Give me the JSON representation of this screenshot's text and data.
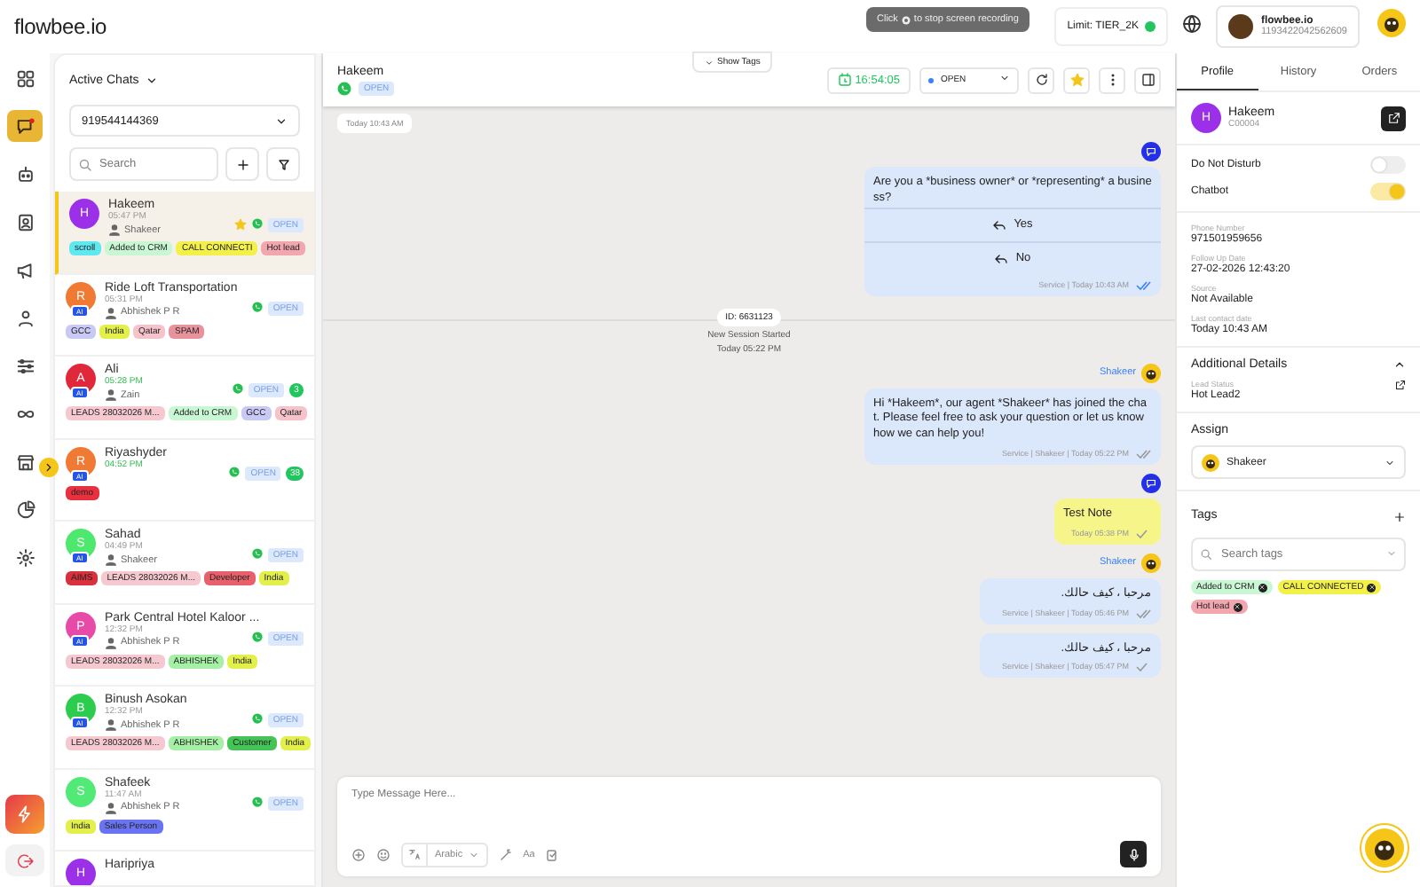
{
  "topbar": {
    "logo": "flowbee.io",
    "recording_tip": {
      "before": "Click",
      "after": "to stop screen recording"
    },
    "limit": "Limit:  TIER_2K",
    "account": {
      "name": "flowbee.io",
      "id": "1193422042562609"
    }
  },
  "nav": [
    {
      "kind": "grid",
      "selected": false
    },
    {
      "kind": "chat",
      "selected": true
    },
    {
      "kind": "bot",
      "selected": false
    },
    {
      "kind": "contact",
      "selected": false
    },
    {
      "kind": "megaphone",
      "selected": false
    },
    {
      "kind": "users",
      "selected": false
    },
    {
      "kind": "sliders",
      "selected": false
    },
    {
      "kind": "infinity",
      "selected": false
    },
    {
      "kind": "store",
      "selected": false
    },
    {
      "kind": "pie",
      "selected": false
    },
    {
      "kind": "gear",
      "selected": false
    }
  ],
  "chat_list": {
    "filter": "Active Chats",
    "number": "919544144369",
    "search_placeholder": "Search",
    "chats": [
      {
        "name": "Hakeem",
        "time": "05:47 PM",
        "agent": "Shakeer",
        "initial": "H",
        "color": "#9b30e8",
        "starred": true,
        "status": "OPEN",
        "selected": true,
        "tags": [
          {
            "label": "scroll",
            "color": "#5ee8f0"
          },
          {
            "label": "Added to CRM",
            "color": "#c9f7d4"
          },
          {
            "label": "CALL CONNECTI",
            "color": "#f3f04a"
          },
          {
            "label": "Hot lead",
            "color": "#f2a6ae"
          }
        ]
      },
      {
        "name": "Ride Loft Transportation",
        "time": "05:31 PM",
        "agent": "Abhishek P R",
        "initial": "R",
        "color": "#f07a34",
        "badge": "AI",
        "starred": false,
        "status": "OPEN",
        "selected": false,
        "tags": [
          {
            "label": "GCC",
            "color": "#c9c9f5"
          },
          {
            "label": "India",
            "color": "#e3f04a"
          },
          {
            "label": "Qatar",
            "color": "#f6c3cb"
          },
          {
            "label": "SPAM",
            "color": "#e8939b"
          }
        ]
      },
      {
        "name": "Ali",
        "time": "05:28 PM",
        "agent": "Zain",
        "initial": "A",
        "color": "#e0283a",
        "badge": "AI",
        "starred": false,
        "status": "OPEN",
        "unread": "3",
        "selected": false,
        "tags": [
          {
            "label": "LEADS 28032026 M...",
            "color": "#f6c8d0"
          },
          {
            "label": "Added to CRM",
            "color": "#c9f7d4"
          },
          {
            "label": "GCC",
            "color": "#c9c9f5"
          },
          {
            "label": "Qatar",
            "color": "#f6c3cb"
          }
        ]
      },
      {
        "name": "Riyashyder",
        "time": "04:52 PM",
        "initial": "R",
        "color": "#f07a34",
        "badge": "AI",
        "starred": false,
        "status": "OPEN",
        "unread": "38",
        "selected": false,
        "tags": [
          {
            "label": "demo",
            "color": "#e8303e"
          }
        ]
      },
      {
        "name": "Sahad",
        "time": "04:49 PM",
        "agent": "Shakeer",
        "initial": "S",
        "color": "#4ee86e",
        "badge": "AI",
        "starred": false,
        "status": "OPEN",
        "selected": false,
        "tags": [
          {
            "label": "AIMS",
            "color": "#d8303c"
          },
          {
            "label": "LEADS 28032026 M...",
            "color": "#f6c8d0"
          },
          {
            "label": "Developer",
            "color": "#e8606c"
          },
          {
            "label": "India",
            "color": "#e3f04a"
          }
        ]
      },
      {
        "name": "Park Central Hotel Kaloor ...",
        "time": "12:32 PM",
        "agent": "Abhishek P R",
        "initial": "P",
        "color": "#e84aa8",
        "badge": "AI",
        "starred": false,
        "status": "OPEN",
        "selected": false,
        "tags": [
          {
            "label": "LEADS 28032026 M...",
            "color": "#f6c8d0"
          },
          {
            "label": "ABHISHEK",
            "color": "#a6f0a6"
          },
          {
            "label": "India",
            "color": "#e3f04a"
          }
        ]
      },
      {
        "name": "Binush Asokan",
        "time": "12:32 PM",
        "agent": "Abhishek P R",
        "initial": "B",
        "color": "#2ccc4e",
        "badge": "AI",
        "starred": false,
        "status": "OPEN",
        "selected": false,
        "tags": [
          {
            "label": "LEADS 28032026 M...",
            "color": "#f6c8d0"
          },
          {
            "label": "ABHISHEK",
            "color": "#a6f0a6"
          },
          {
            "label": "Customer",
            "color": "#44c456"
          },
          {
            "label": "India",
            "color": "#e3f04a"
          }
        ]
      },
      {
        "name": "Shafeek",
        "time": "11:47 AM",
        "agent": "Abhishek P R",
        "initial": "S",
        "color": "#52ea76",
        "starred": false,
        "status": "OPEN",
        "selected": false,
        "tags": [
          {
            "label": "India",
            "color": "#e3f04a"
          },
          {
            "label": "Sales Person",
            "color": "#6a74f2"
          }
        ]
      },
      {
        "name": "Haripriya",
        "initial": "H",
        "color": "#9b30e8",
        "starred": false,
        "selected": false
      }
    ]
  },
  "conversation": {
    "name": "Hakeem",
    "status_badge": "OPEN",
    "show_tags": "Show Tags",
    "timer": "16:54:05",
    "status": "OPEN",
    "starred": true,
    "items": [
      {
        "kind": "date",
        "text": "Today 10:43 AM"
      },
      {
        "kind": "bot",
        "text": "Are you a *business owner* or *representing* a business?",
        "buttons": [
          "Yes",
          "No"
        ],
        "meta": "Service | Today 10:43 AM",
        "delivered": true,
        "read": true
      },
      {
        "kind": "session",
        "id": "ID: 6631123",
        "text": "New Session Started",
        "time": "Today 05:22 PM"
      },
      {
        "kind": "agent",
        "sender": "Shakeer",
        "text": "Hi *Hakeem*, our agent *Shakeer* has joined the chat. Please feel free to ask your question or let us know how we can help you!",
        "meta": "Service | Shakeer | Today 05:22 PM",
        "delivered": true,
        "read": false
      },
      {
        "kind": "note",
        "text": "Test Note",
        "meta": "Today 05:38 PM",
        "delivered": false,
        "read": false
      },
      {
        "kind": "agent",
        "sender": "Shakeer",
        "text": "مرحبا ، كيف حالك.",
        "meta": "Service | Shakeer | Today 05:46 PM",
        "delivered": true,
        "read": false
      },
      {
        "kind": "agent",
        "text": "مرحبا ، كيف حالك.",
        "meta": "Service | Shakeer | Today 05:47 PM",
        "delivered": false,
        "read": false
      }
    ],
    "composer": {
      "placeholder": "Type Message Here...",
      "language": "Arabic",
      "font_button": "Aa"
    }
  },
  "profile": {
    "tabs": [
      {
        "label": "Profile",
        "selected": true
      },
      {
        "label": "History",
        "selected": false
      },
      {
        "label": "Orders",
        "selected": false
      }
    ],
    "name": "Hakeem",
    "code": "C00004",
    "initial": "H",
    "toggles": [
      {
        "label": "Do Not Disturb",
        "on": false
      },
      {
        "label": "Chatbot",
        "on": true
      }
    ],
    "fields": [
      {
        "label": "Phone Number",
        "value": "971501959656"
      },
      {
        "label": "Follow Up Date",
        "value": "27-02-2026 12:43:20"
      },
      {
        "label": "Source",
        "value": "Not Available"
      },
      {
        "label": "Last contact date",
        "value": "Today 10:43 AM"
      }
    ],
    "additional": {
      "title": "Additional Details",
      "expanded": true,
      "label": "Lead Status",
      "value": "Hot Lead2"
    },
    "assign": {
      "title": "Assign",
      "value": "Shakeer"
    },
    "tags": {
      "title": "Tags",
      "placeholder": "Search tags",
      "items": [
        {
          "label": "Added to CRM",
          "color": "#c9f7d4"
        },
        {
          "label": "CALL CONNECTED",
          "color": "#f3f04a"
        },
        {
          "label": "Hot lead",
          "color": "#f2a6ae"
        }
      ]
    }
  }
}
